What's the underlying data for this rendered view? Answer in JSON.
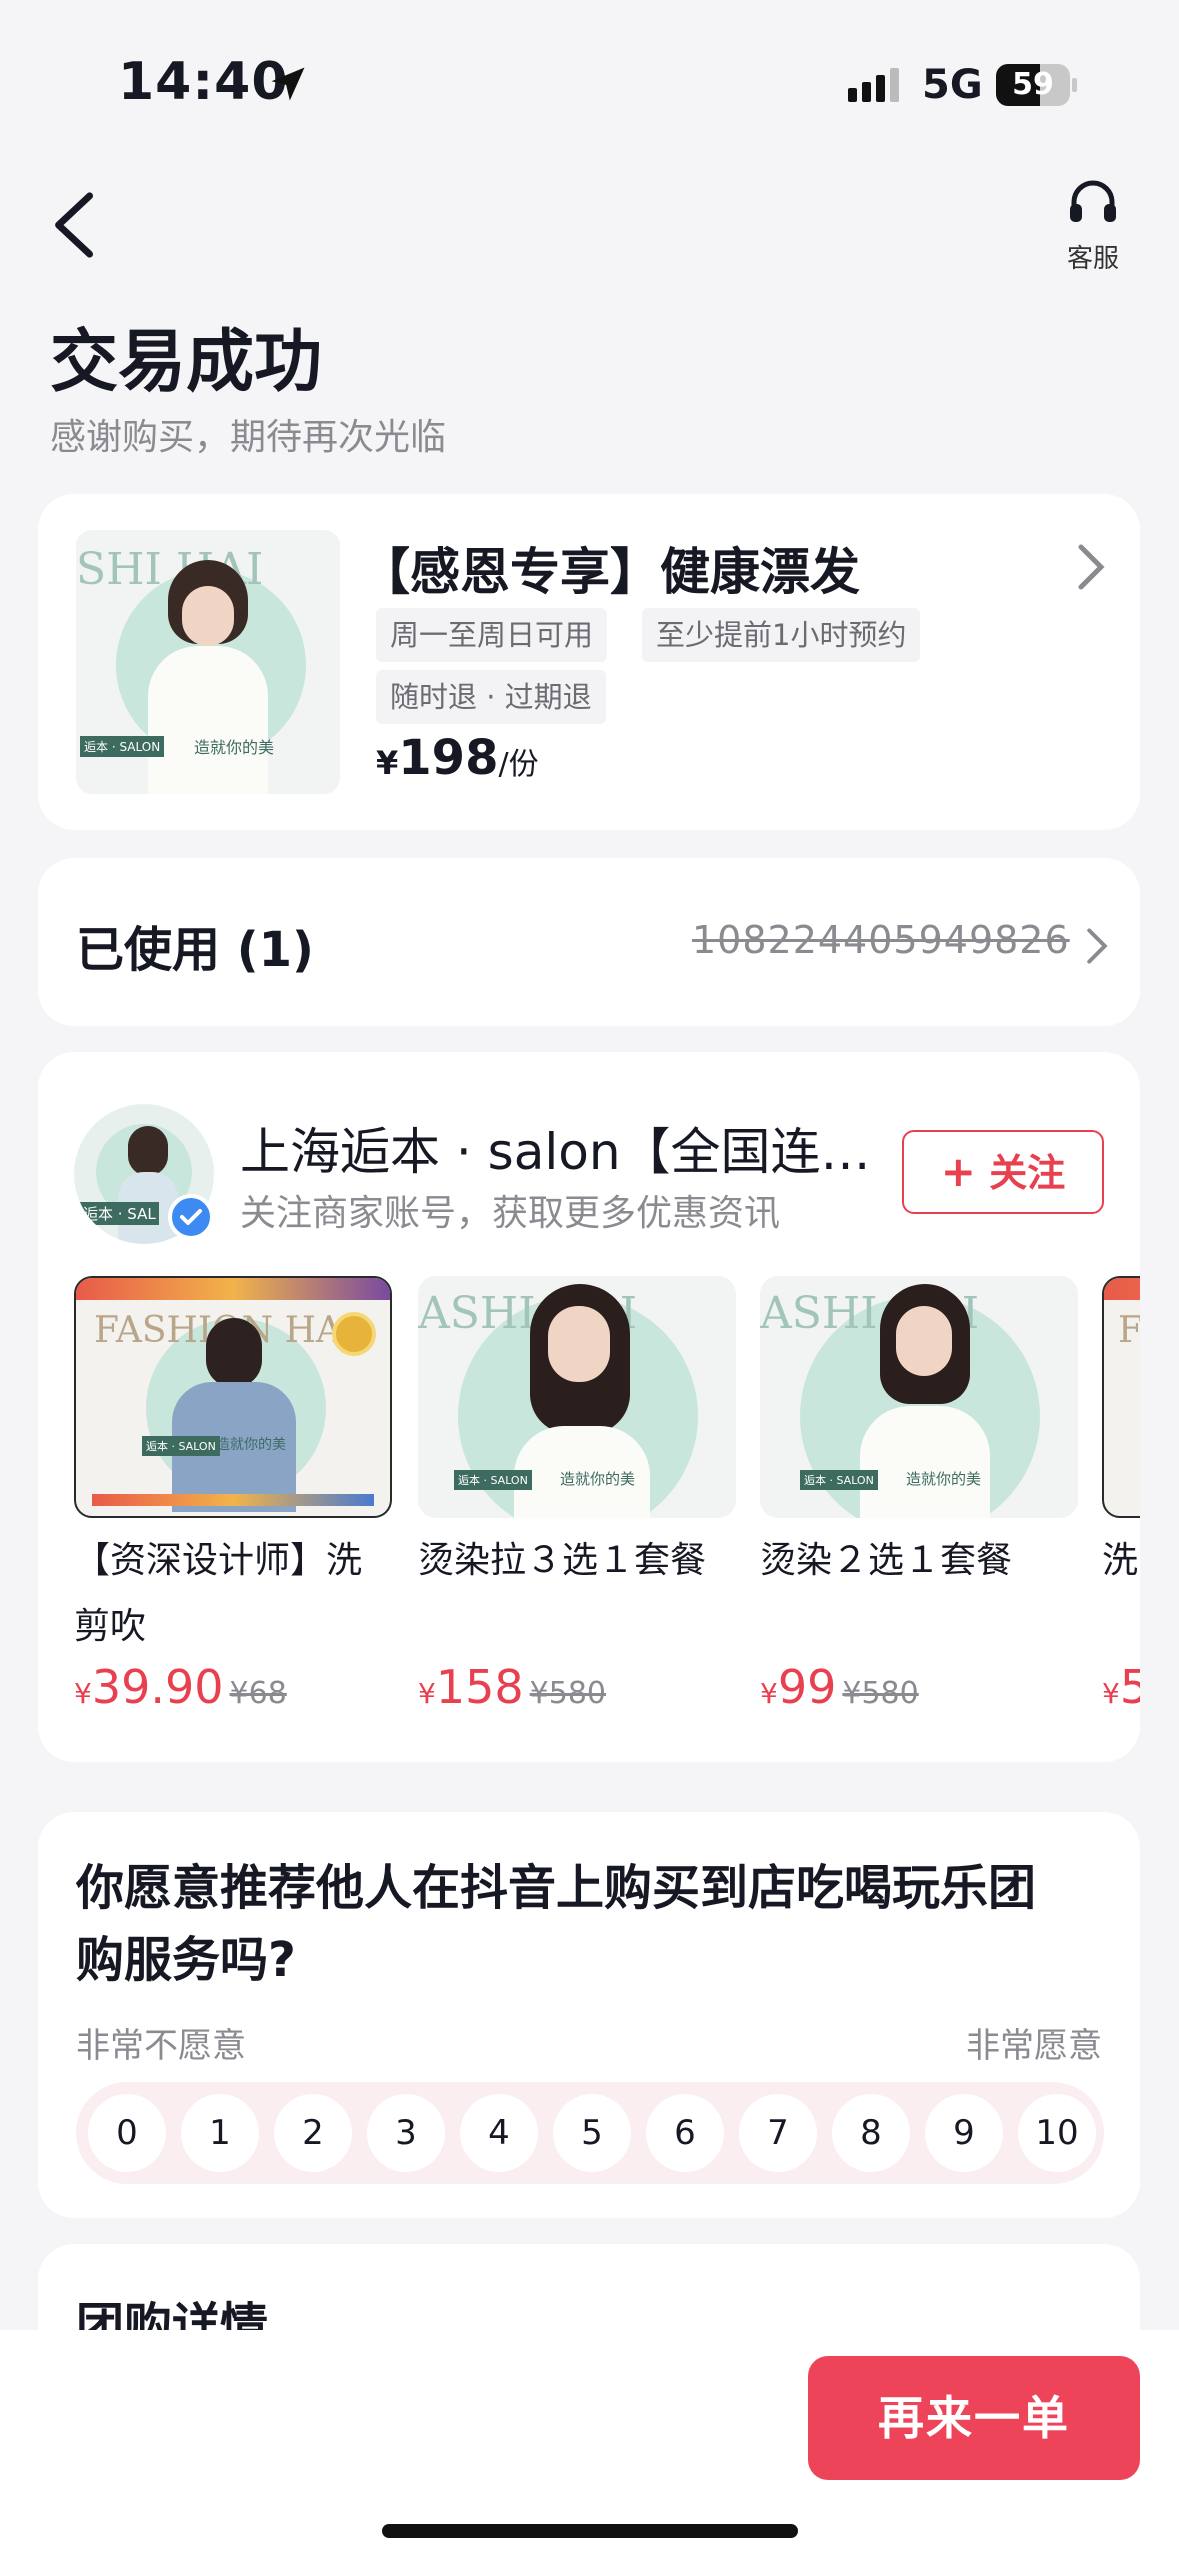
{
  "status_bar": {
    "time": "14:40",
    "network": "5G",
    "battery": "59"
  },
  "header": {
    "service_label": "客服",
    "title": "交易成功",
    "subtitle": "感谢购买，期待再次光临"
  },
  "product": {
    "title": "【感恩专享】健康漂发",
    "tags": [
      "周一至周日可用",
      "至少提前1小时预约",
      "随时退 · 过期退"
    ],
    "price_currency": "¥",
    "price": "198",
    "price_unit": "/份",
    "image_text": {
      "brand": "SHI HAI",
      "tag": "逅本 · SALON",
      "slogan": "造就你的美"
    }
  },
  "usage": {
    "label": "已使用 (1)",
    "code": "108224405949826"
  },
  "merchant": {
    "name": "上海逅本 · salon【全国连…",
    "desc": "关注商家账号，获取更多优惠资讯",
    "follow_label": "关注",
    "avatar_text": "逅本 · SAL",
    "deals": [
      {
        "name": "【资深设计师】洗剪吹",
        "currency": "¥",
        "price": "39.90",
        "original": "¥68",
        "img_brand": "FASHION HAI",
        "img_tag": "逅本 · SALON",
        "img_slogan": "造就你的美"
      },
      {
        "name": "烫染拉３选１套餐",
        "currency": "¥",
        "price": "158",
        "original": "¥580",
        "img_brand": "ASHI HAI",
        "img_tag": "逅本 · SALON",
        "img_slogan": "造就你的美"
      },
      {
        "name": "烫染２选１套餐",
        "currency": "¥",
        "price": "99",
        "original": "¥580",
        "img_brand": "ASHI HAI",
        "img_tag": "逅本 · SALON",
        "img_slogan": "造就你的美"
      },
      {
        "name": "洗",
        "currency": "¥",
        "price": "5",
        "original": "",
        "img_brand": "F",
        "img_tag": "",
        "img_slogan": ""
      }
    ]
  },
  "survey": {
    "question": "你愿意推荐他人在抖音上购买到店吃喝玩乐团购服务吗?",
    "min_label": "非常不愿意",
    "max_label": "非常愿意",
    "scores": [
      "0",
      "1",
      "2",
      "3",
      "4",
      "5",
      "6",
      "7",
      "8",
      "9",
      "10"
    ]
  },
  "details": {
    "title": "团购详情"
  },
  "bottom": {
    "reorder_label": "再来一单"
  },
  "colors": {
    "accent": "#ee4459",
    "verified": "#3d8bf2",
    "mint": "#c8e6dc"
  }
}
